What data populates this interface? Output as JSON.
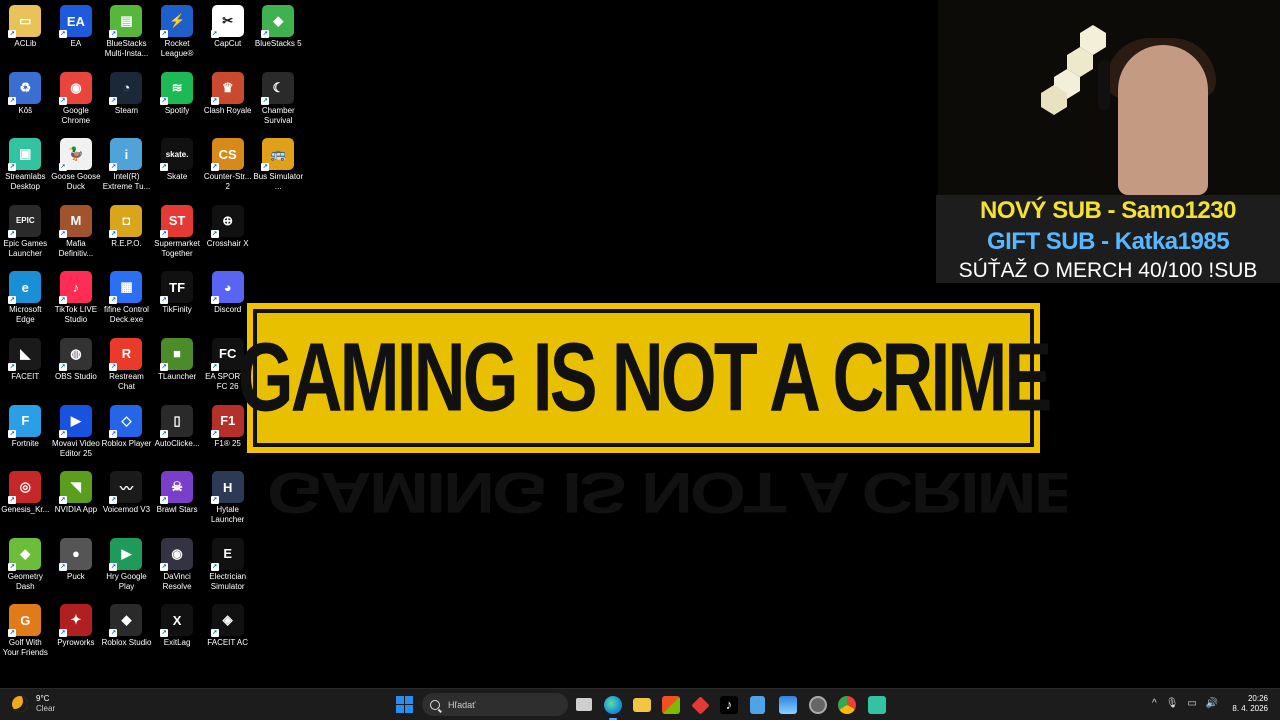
{
  "desktop": {
    "icons": [
      {
        "label": "ACLib",
        "color": "#e9c25a",
        "glyph": "▭"
      },
      {
        "label": "Kôš",
        "color": "#3a6fd1",
        "glyph": "♻"
      },
      {
        "label": "Streamlabs Desktop",
        "color": "#31c3a2",
        "glyph": "▣"
      },
      {
        "label": "Epic Games Launcher",
        "color": "#2a2a2a",
        "glyph": "EPIC"
      },
      {
        "label": "Microsoft Edge",
        "color": "#1a8fd6",
        "glyph": "e"
      },
      {
        "label": "FACEIT",
        "color": "#1a1a1a",
        "glyph": "◣"
      },
      {
        "label": "Fortnite",
        "color": "#2a9fe8",
        "glyph": "F"
      },
      {
        "label": "Genesis_Kr...",
        "color": "#c62828",
        "glyph": "◎"
      },
      {
        "label": "Geometry Dash",
        "color": "#6bbd3a",
        "glyph": "◆"
      },
      {
        "label": "Golf With Your Friends",
        "color": "#e07b1c",
        "glyph": "G"
      },
      {
        "label": "EA",
        "color": "#1e5bdc",
        "glyph": "EA"
      },
      {
        "label": "Google Chrome",
        "color": "#e8453c",
        "glyph": "◉"
      },
      {
        "label": "Goose Goose Duck",
        "color": "#f1f1f1",
        "glyph": "🦆"
      },
      {
        "label": "Mafia Definitiv...",
        "color": "#a0532d",
        "glyph": "M"
      },
      {
        "label": "TikTok LIVE Studio",
        "color": "#ff2c55",
        "glyph": "♪"
      },
      {
        "label": "OBS Studio",
        "color": "#333",
        "glyph": "◍"
      },
      {
        "label": "Movavi Video Editor 25",
        "color": "#1a52e0",
        "glyph": "▶"
      },
      {
        "label": "NVIDIA App",
        "color": "#5b9e1e",
        "glyph": "◥"
      },
      {
        "label": "Puck",
        "color": "#555",
        "glyph": "●"
      },
      {
        "label": "Pyroworks",
        "color": "#b02020",
        "glyph": "✦"
      },
      {
        "label": "BlueStacks Multi-Insta...",
        "color": "#56b73a",
        "glyph": "▤"
      },
      {
        "label": "Steam",
        "color": "#1b2838",
        "glyph": "◔"
      },
      {
        "label": "Intel(R) Extreme Tu...",
        "color": "#4fa3d9",
        "glyph": "i"
      },
      {
        "label": "R.E.P.O.",
        "color": "#d9a51a",
        "glyph": "◘"
      },
      {
        "label": "fifine Control Deck.exe",
        "color": "#2b6ff2",
        "glyph": "▦"
      },
      {
        "label": "Restream Chat",
        "color": "#e93a2a",
        "glyph": "R"
      },
      {
        "label": "Roblox Player",
        "color": "#2566e8",
        "glyph": "◇"
      },
      {
        "label": "Voicemod V3",
        "color": "#1a1a1a",
        "glyph": "〰"
      },
      {
        "label": "Hry Google Play",
        "color": "#1e9a5a",
        "glyph": "▶"
      },
      {
        "label": "Roblox Studio",
        "color": "#2a2a2a",
        "glyph": "◆"
      },
      {
        "label": "Rocket League®",
        "color": "#1f5fc9",
        "glyph": "⚡"
      },
      {
        "label": "Spotify",
        "color": "#1db954",
        "glyph": "≋"
      },
      {
        "label": "Skate",
        "color": "#111",
        "glyph": "skate."
      },
      {
        "label": "Supermarket Together",
        "color": "#e53935",
        "glyph": "ST"
      },
      {
        "label": "TikFinity",
        "color": "#111",
        "glyph": "TF"
      },
      {
        "label": "TLauncher",
        "color": "#4c8b2a",
        "glyph": "■"
      },
      {
        "label": "AutoClicke...",
        "color": "#2a2a2a",
        "glyph": "▯"
      },
      {
        "label": "Brawl Stars",
        "color": "#7a3fc9",
        "glyph": "☠"
      },
      {
        "label": "DaVinci Resolve",
        "color": "#334",
        "glyph": "◉"
      },
      {
        "label": "ExitLag",
        "color": "#111",
        "glyph": "X"
      },
      {
        "label": "CapCut",
        "color": "#fff",
        "glyph": "✂"
      },
      {
        "label": "Clash Royale",
        "color": "#c94a2e",
        "glyph": "♛"
      },
      {
        "label": "Counter-Str... 2",
        "color": "#d78a1a",
        "glyph": "CS"
      },
      {
        "label": "Crosshair X",
        "color": "#111",
        "glyph": "⊕"
      },
      {
        "label": "Discord",
        "color": "#5865f2",
        "glyph": "◕"
      },
      {
        "label": "EA SPORTS FC 26",
        "color": "#111",
        "glyph": "FC"
      },
      {
        "label": "F1® 25",
        "color": "#b5302a",
        "glyph": "F1"
      },
      {
        "label": "Hytale Launcher",
        "color": "#2c3a55",
        "glyph": "H"
      },
      {
        "label": "Electrician Simulator",
        "color": "#111",
        "glyph": "E"
      },
      {
        "label": "FACEIT AC",
        "color": "#111",
        "glyph": "◈"
      },
      {
        "label": "BlueStacks 5",
        "color": "#3fb14e",
        "glyph": "◆"
      },
      {
        "label": "Chamber Survival",
        "color": "#2a2a2a",
        "glyph": "☾"
      },
      {
        "label": "Bus Simulator ...",
        "color": "#e0a01a",
        "glyph": "🚌"
      }
    ]
  },
  "banner": {
    "text": "GAMING IS NOT A CRIME",
    "accent": "#f2c200"
  },
  "stream_overlay": {
    "line1": "NOVÝ SUB - Samo1230",
    "line2": "GIFT SUB - Katka1985",
    "line3": "SÚŤAŽ O MERCH  40/100 !SUB"
  },
  "taskbar": {
    "weather_temp": "9°C",
    "weather_desc": "Clear",
    "search_placeholder": "Hľadať",
    "time": "20:26",
    "date": "8. 4. 2026",
    "tray_chevron": "^"
  }
}
